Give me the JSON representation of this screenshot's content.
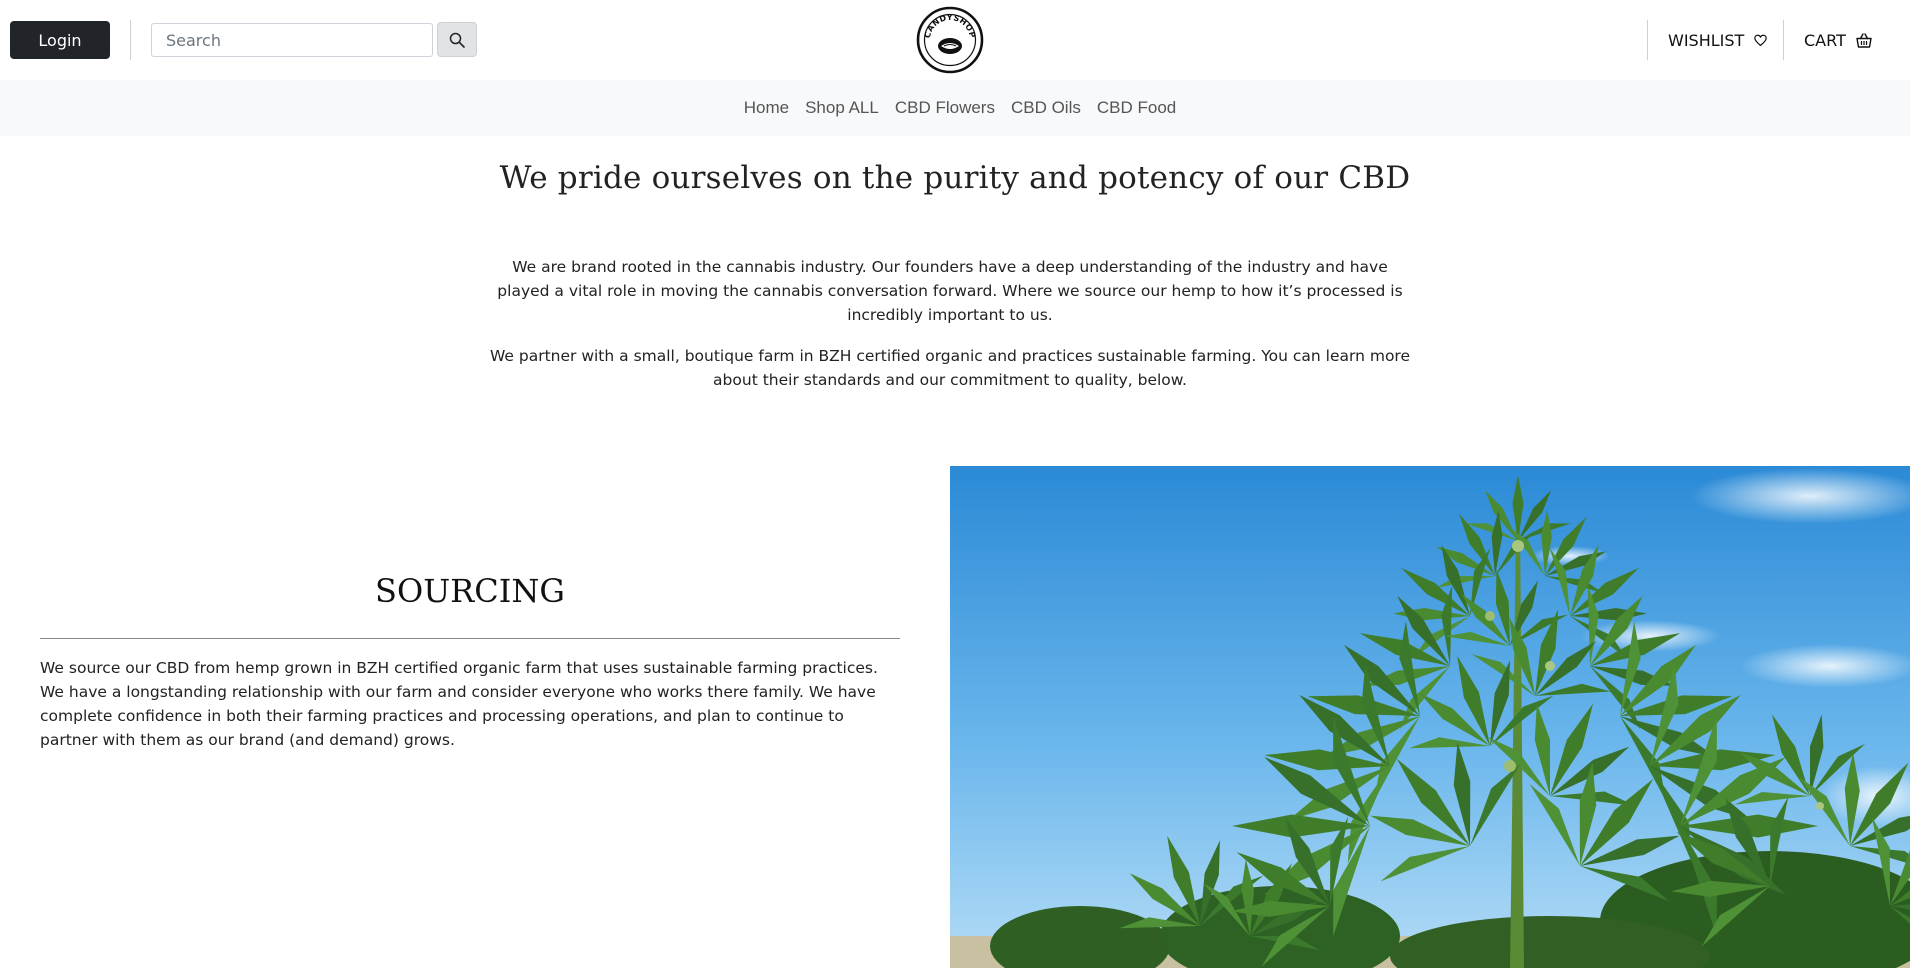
{
  "header": {
    "login_label": "Login",
    "search_placeholder": "Search",
    "logo_text": "CANDYSHOP",
    "wishlist_label": "WISHLIST",
    "cart_label": "CART"
  },
  "nav": {
    "items": [
      "Home",
      "Shop ALL",
      "CBD Flowers",
      "CBD Oils",
      "CBD Food"
    ]
  },
  "intro": {
    "title": "We pride ourselves on the purity and potency of our CBD",
    "paragraph_1": "We are brand rooted in the cannabis industry. Our founders have a deep understanding of the industry and have played a vital role in moving the cannabis conversation forward. Where we source our hemp to how it’s processed is incredibly important to us.",
    "paragraph_2": "We partner with a small, boutique farm in BZH certified organic and practices sustainable farming. You can learn more about their standards and our commitment to quality, below."
  },
  "sourcing": {
    "title": "SOURCING",
    "text": "We source our CBD from hemp grown in BZH certified organic farm that uses sustainable farming practices. We have a longstanding relationship with our farm and consider everyone who works there family. We have complete confidence in both their farming practices and processing operations, and plan to continue to partner with them as our brand (and demand) grows."
  },
  "icons": {
    "search": "search-icon",
    "wishlist": "heart-icon",
    "cart": "basket-icon"
  },
  "colors": {
    "login_bg": "#212529",
    "nav_bg": "#f8f9fa",
    "sky_top": "#2f8fd8",
    "sky_bottom": "#a9d6f5",
    "leaf": "#3f7a2a"
  }
}
